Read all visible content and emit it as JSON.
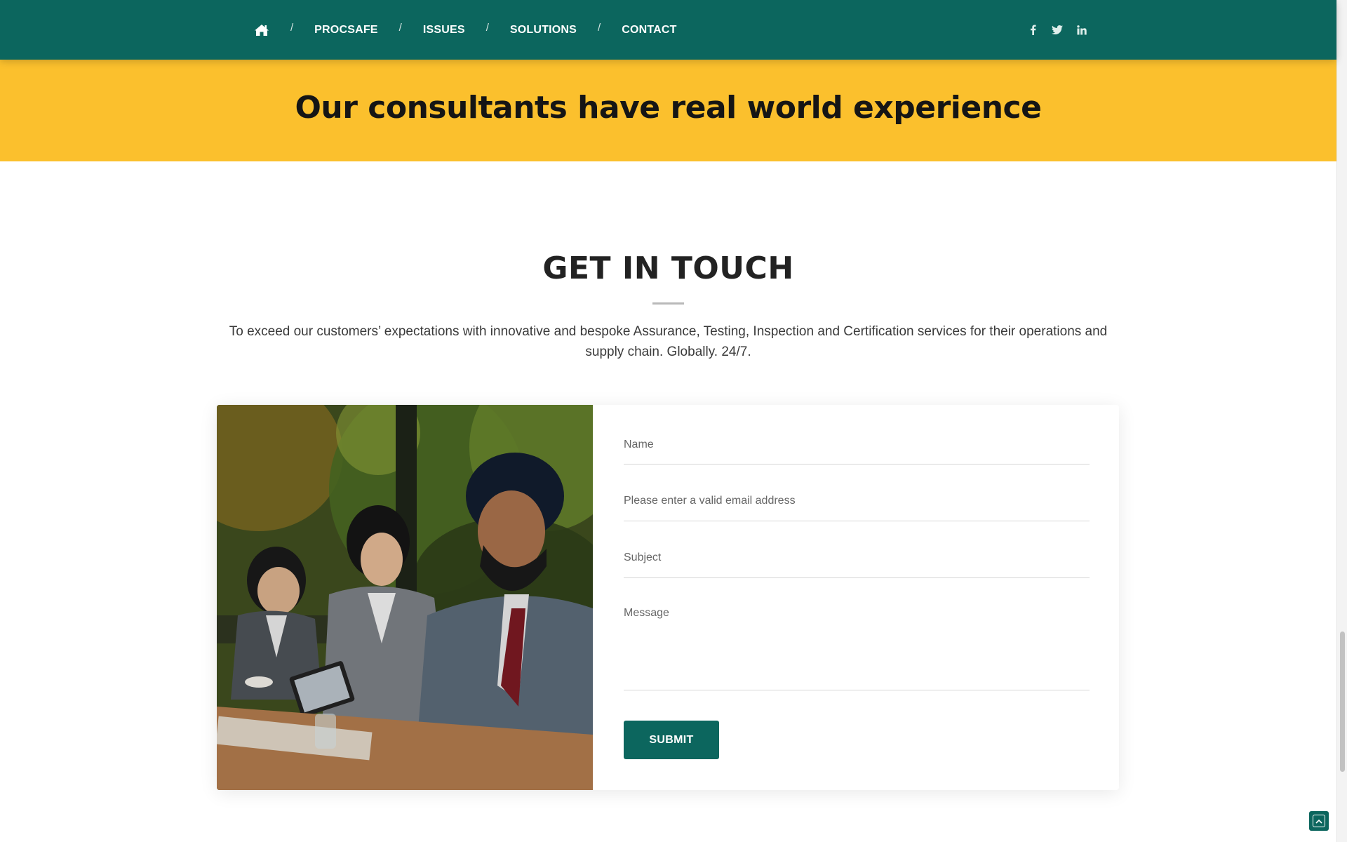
{
  "nav": {
    "home_icon": "home-icon",
    "separator": "/",
    "items": [
      {
        "label": "PROCSAFE"
      },
      {
        "label": "ISSUES"
      },
      {
        "label": "SOLUTIONS"
      },
      {
        "label": "CONTACT"
      }
    ],
    "socials": [
      "facebook-icon",
      "twitter-icon",
      "linkedin-icon"
    ]
  },
  "banner": {
    "heading": "Our consultants have real world experience"
  },
  "contact": {
    "title": "GET IN TOUCH",
    "intro": "To exceed our customers’ expectations with innovative and bespoke Assurance, Testing, Inspection and Certification services for their operations and supply chain. Globally. 24/7.",
    "form": {
      "name_placeholder": "Name",
      "email_placeholder": "Please enter a valid email address",
      "subject_placeholder": "Subject",
      "message_placeholder": "Message",
      "submit_label": "SUBMIT"
    }
  },
  "colors": {
    "primary": "#0c665e",
    "accent": "#fbc02d",
    "text_dark": "#222222"
  },
  "back_to_top_icon": "chevron-up-icon"
}
